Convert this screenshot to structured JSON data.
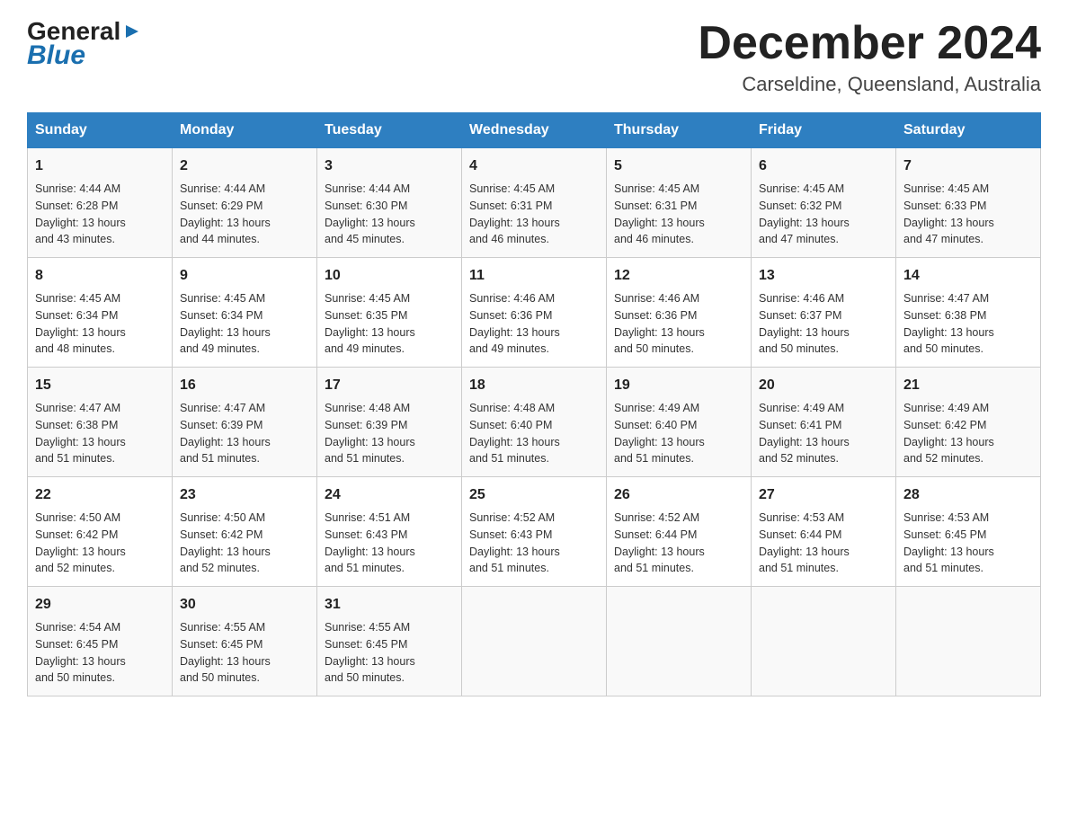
{
  "header": {
    "logo_general": "General",
    "logo_blue": "Blue",
    "month_title": "December 2024",
    "location": "Carseldine, Queensland, Australia"
  },
  "days_of_week": [
    "Sunday",
    "Monday",
    "Tuesday",
    "Wednesday",
    "Thursday",
    "Friday",
    "Saturday"
  ],
  "weeks": [
    [
      {
        "day": "1",
        "sunrise": "4:44 AM",
        "sunset": "6:28 PM",
        "daylight": "13 hours and 43 minutes."
      },
      {
        "day": "2",
        "sunrise": "4:44 AM",
        "sunset": "6:29 PM",
        "daylight": "13 hours and 44 minutes."
      },
      {
        "day": "3",
        "sunrise": "4:44 AM",
        "sunset": "6:30 PM",
        "daylight": "13 hours and 45 minutes."
      },
      {
        "day": "4",
        "sunrise": "4:45 AM",
        "sunset": "6:31 PM",
        "daylight": "13 hours and 46 minutes."
      },
      {
        "day": "5",
        "sunrise": "4:45 AM",
        "sunset": "6:31 PM",
        "daylight": "13 hours and 46 minutes."
      },
      {
        "day": "6",
        "sunrise": "4:45 AM",
        "sunset": "6:32 PM",
        "daylight": "13 hours and 47 minutes."
      },
      {
        "day": "7",
        "sunrise": "4:45 AM",
        "sunset": "6:33 PM",
        "daylight": "13 hours and 47 minutes."
      }
    ],
    [
      {
        "day": "8",
        "sunrise": "4:45 AM",
        "sunset": "6:34 PM",
        "daylight": "13 hours and 48 minutes."
      },
      {
        "day": "9",
        "sunrise": "4:45 AM",
        "sunset": "6:34 PM",
        "daylight": "13 hours and 49 minutes."
      },
      {
        "day": "10",
        "sunrise": "4:45 AM",
        "sunset": "6:35 PM",
        "daylight": "13 hours and 49 minutes."
      },
      {
        "day": "11",
        "sunrise": "4:46 AM",
        "sunset": "6:36 PM",
        "daylight": "13 hours and 49 minutes."
      },
      {
        "day": "12",
        "sunrise": "4:46 AM",
        "sunset": "6:36 PM",
        "daylight": "13 hours and 50 minutes."
      },
      {
        "day": "13",
        "sunrise": "4:46 AM",
        "sunset": "6:37 PM",
        "daylight": "13 hours and 50 minutes."
      },
      {
        "day": "14",
        "sunrise": "4:47 AM",
        "sunset": "6:38 PM",
        "daylight": "13 hours and 50 minutes."
      }
    ],
    [
      {
        "day": "15",
        "sunrise": "4:47 AM",
        "sunset": "6:38 PM",
        "daylight": "13 hours and 51 minutes."
      },
      {
        "day": "16",
        "sunrise": "4:47 AM",
        "sunset": "6:39 PM",
        "daylight": "13 hours and 51 minutes."
      },
      {
        "day": "17",
        "sunrise": "4:48 AM",
        "sunset": "6:39 PM",
        "daylight": "13 hours and 51 minutes."
      },
      {
        "day": "18",
        "sunrise": "4:48 AM",
        "sunset": "6:40 PM",
        "daylight": "13 hours and 51 minutes."
      },
      {
        "day": "19",
        "sunrise": "4:49 AM",
        "sunset": "6:40 PM",
        "daylight": "13 hours and 51 minutes."
      },
      {
        "day": "20",
        "sunrise": "4:49 AM",
        "sunset": "6:41 PM",
        "daylight": "13 hours and 52 minutes."
      },
      {
        "day": "21",
        "sunrise": "4:49 AM",
        "sunset": "6:42 PM",
        "daylight": "13 hours and 52 minutes."
      }
    ],
    [
      {
        "day": "22",
        "sunrise": "4:50 AM",
        "sunset": "6:42 PM",
        "daylight": "13 hours and 52 minutes."
      },
      {
        "day": "23",
        "sunrise": "4:50 AM",
        "sunset": "6:42 PM",
        "daylight": "13 hours and 52 minutes."
      },
      {
        "day": "24",
        "sunrise": "4:51 AM",
        "sunset": "6:43 PM",
        "daylight": "13 hours and 51 minutes."
      },
      {
        "day": "25",
        "sunrise": "4:52 AM",
        "sunset": "6:43 PM",
        "daylight": "13 hours and 51 minutes."
      },
      {
        "day": "26",
        "sunrise": "4:52 AM",
        "sunset": "6:44 PM",
        "daylight": "13 hours and 51 minutes."
      },
      {
        "day": "27",
        "sunrise": "4:53 AM",
        "sunset": "6:44 PM",
        "daylight": "13 hours and 51 minutes."
      },
      {
        "day": "28",
        "sunrise": "4:53 AM",
        "sunset": "6:45 PM",
        "daylight": "13 hours and 51 minutes."
      }
    ],
    [
      {
        "day": "29",
        "sunrise": "4:54 AM",
        "sunset": "6:45 PM",
        "daylight": "13 hours and 50 minutes."
      },
      {
        "day": "30",
        "sunrise": "4:55 AM",
        "sunset": "6:45 PM",
        "daylight": "13 hours and 50 minutes."
      },
      {
        "day": "31",
        "sunrise": "4:55 AM",
        "sunset": "6:45 PM",
        "daylight": "13 hours and 50 minutes."
      },
      null,
      null,
      null,
      null
    ]
  ],
  "labels": {
    "sunrise": "Sunrise:",
    "sunset": "Sunset:",
    "daylight": "Daylight:"
  }
}
